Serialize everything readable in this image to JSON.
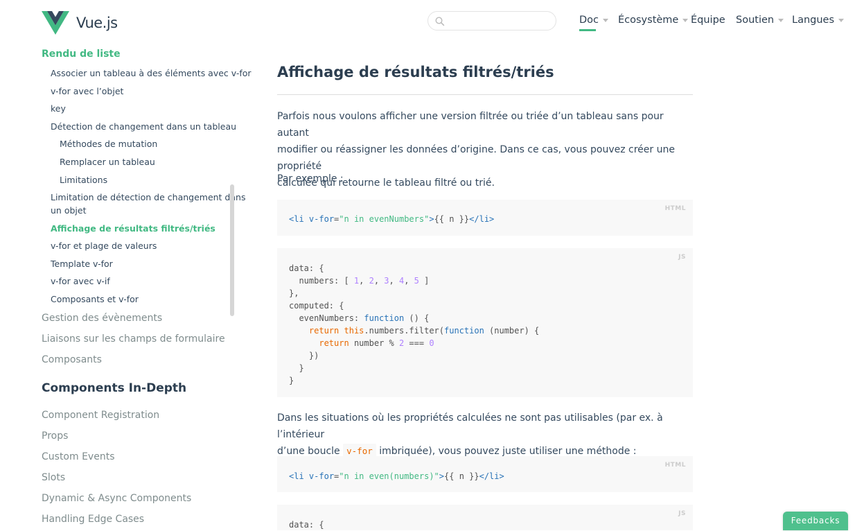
{
  "header": {
    "logo_text": "Vue.js",
    "search_placeholder": "",
    "nav": [
      {
        "label": "Doc",
        "dropdown": true,
        "active": true
      },
      {
        "label": "Écosystème",
        "dropdown": true
      },
      {
        "label": "Équipe",
        "dropdown": false
      },
      {
        "label": "Soutien",
        "dropdown": true
      },
      {
        "label": "Langues",
        "dropdown": true
      }
    ]
  },
  "sidebar": {
    "section_title": "Rendu de liste",
    "subitems": [
      "Associer un tableau à des éléments avec v-for",
      "v-for avec l’objet",
      "key",
      "Détection de changement dans un tableau",
      "Méthodes de mutation",
      "Remplacer un tableau",
      "Limitations",
      "Limitation de détection de changement dans",
      "un objet",
      "Affichage de résultats filtrés/triés",
      "v-for et plage de valeurs",
      "Template v-for",
      "v-for avec v-if",
      "Composants et v-for"
    ],
    "top_items": [
      "Gestion des évènements",
      "Liaisons sur les champs de formulaire",
      "Composants"
    ],
    "section2_title": "Components In-Depth",
    "section2_items": [
      "Component Registration",
      "Props",
      "Custom Events",
      "Slots",
      "Dynamic & Async Components",
      "Handling Edge Cases"
    ]
  },
  "content": {
    "title": "Affichage de résultats filtrés/triés",
    "para1_lines": [
      "Parfois nous voulons afficher une version filtrée ou triée d’un tableau sans pour autant",
      "modifier ou réassigner les données d’origine. Dans ce cas, vous pouvez créer une propriété",
      "calculée qui retourne le tableau filtré ou trié."
    ],
    "para2": "Par exemple :",
    "code1_lang": "HTML",
    "code2_lang": "JS",
    "para3_line1": "Dans les situations où les propriétés calculées ne sont pas utilisables (par ex. à l’intérieur",
    "para3_line2_pre": "d’une boucle",
    "para3_inline_code": "v-for",
    "para3_line2_post": "imbriquée), vous pouvez juste utiliser une méthode :",
    "code3_lang": "HTML",
    "code4_lang": "JS",
    "code4_first_line": "data: {"
  },
  "feedback_label": "Feedbacks",
  "colors": {
    "accent": "#42b983",
    "text": "#34495e",
    "code_bg": "#f8f8f8"
  }
}
